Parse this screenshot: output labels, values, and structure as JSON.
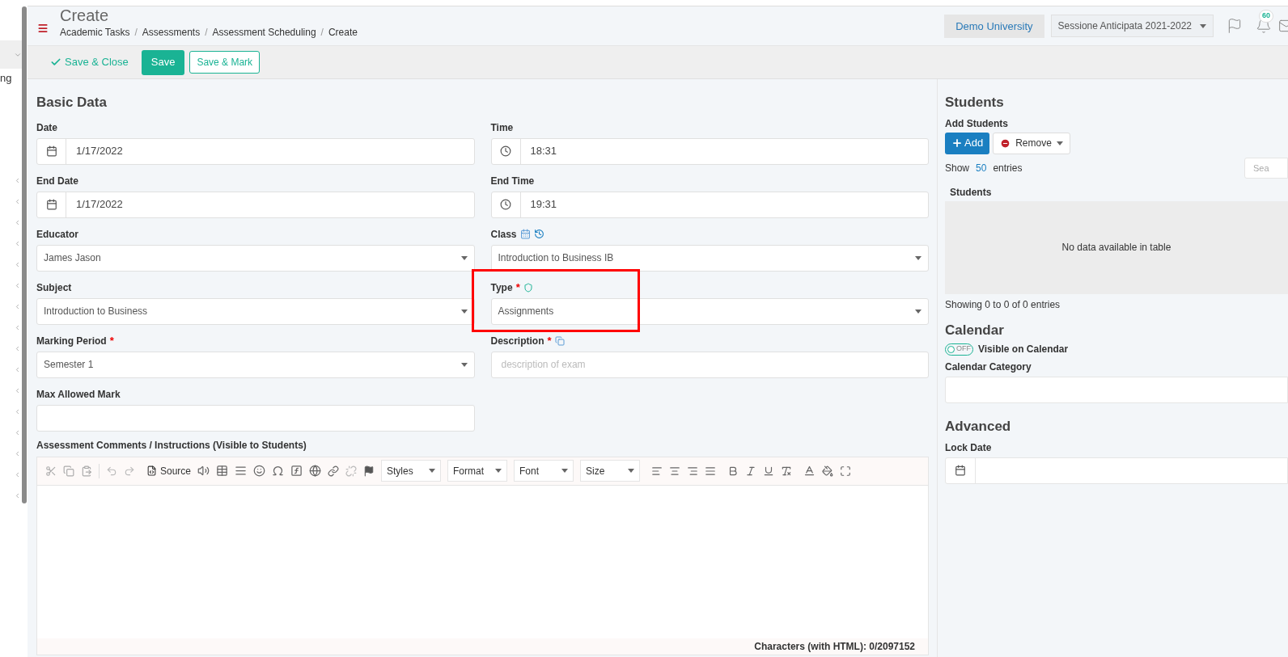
{
  "page": {
    "title": "Create",
    "breadcrumbs": [
      "Academic Tasks",
      "Assessments",
      "Assessment Scheduling",
      "Create"
    ],
    "separator": "/"
  },
  "header": {
    "institution": "Demo University",
    "session": "Sessione Anticipata 2021-2022",
    "notification_count": "60"
  },
  "sidebar": {
    "items": [
      {
        "label": "ng"
      }
    ]
  },
  "actions": [
    {
      "label": "Save & Close",
      "kind": "link"
    },
    {
      "label": "Save",
      "kind": "primary"
    },
    {
      "label": "Save & Mark",
      "kind": "outline"
    }
  ],
  "basic_data": {
    "title": "Basic Data",
    "fields": [
      {
        "label": "Date",
        "kind": "date",
        "value": "1/17/2022"
      },
      {
        "label": "Time",
        "kind": "time",
        "value": "18:31"
      },
      {
        "label": "End Date",
        "kind": "date",
        "value": "1/17/2022"
      },
      {
        "label": "End Time",
        "kind": "time",
        "value": "19:31"
      },
      {
        "label": "Educator",
        "kind": "select",
        "value": "James Jason"
      },
      {
        "label": "Class",
        "kind": "select",
        "value": "Introduction to Business IB",
        "class_icons": true
      },
      {
        "label": "Subject",
        "kind": "select",
        "value": "Introduction to Business"
      },
      {
        "label": "Type",
        "kind": "select",
        "value": "Assignments",
        "required_mark": "*",
        "type_icon": true,
        "highlighted": true
      },
      {
        "label": "Marking Period",
        "kind": "select",
        "value": "Semester 1",
        "required_mark": "*"
      },
      {
        "label": "Description",
        "kind": "text",
        "placeholder": "description of exam",
        "required_mark": "*",
        "copy_icon": true
      },
      {
        "label": "Max Allowed Mark",
        "kind": "text"
      }
    ]
  },
  "editor": {
    "label": "Assessment Comments / Instructions (Visible to Students)",
    "source": "Source",
    "dropdowns": [
      "Styles",
      "Format",
      "Font",
      "Size"
    ],
    "char_count": "Characters (with HTML): 0/2097152"
  },
  "students": {
    "title": "Students",
    "subtitle": "Add Students",
    "add": "Add",
    "remove": "Remove",
    "show": "Show",
    "page_size": "50",
    "entries": "entries",
    "search_placeholder": "Sea",
    "column": "Students",
    "empty": "No data available in table",
    "info": "Showing 0 to 0 of 0 entries"
  },
  "calendar": {
    "title": "Calendar",
    "toggle_label": "OFF",
    "on": false,
    "visible_label": "Visible on Calendar",
    "category_label": "Calendar Category"
  },
  "advanced": {
    "title": "Advanced",
    "lock_label": "Lock Date"
  }
}
